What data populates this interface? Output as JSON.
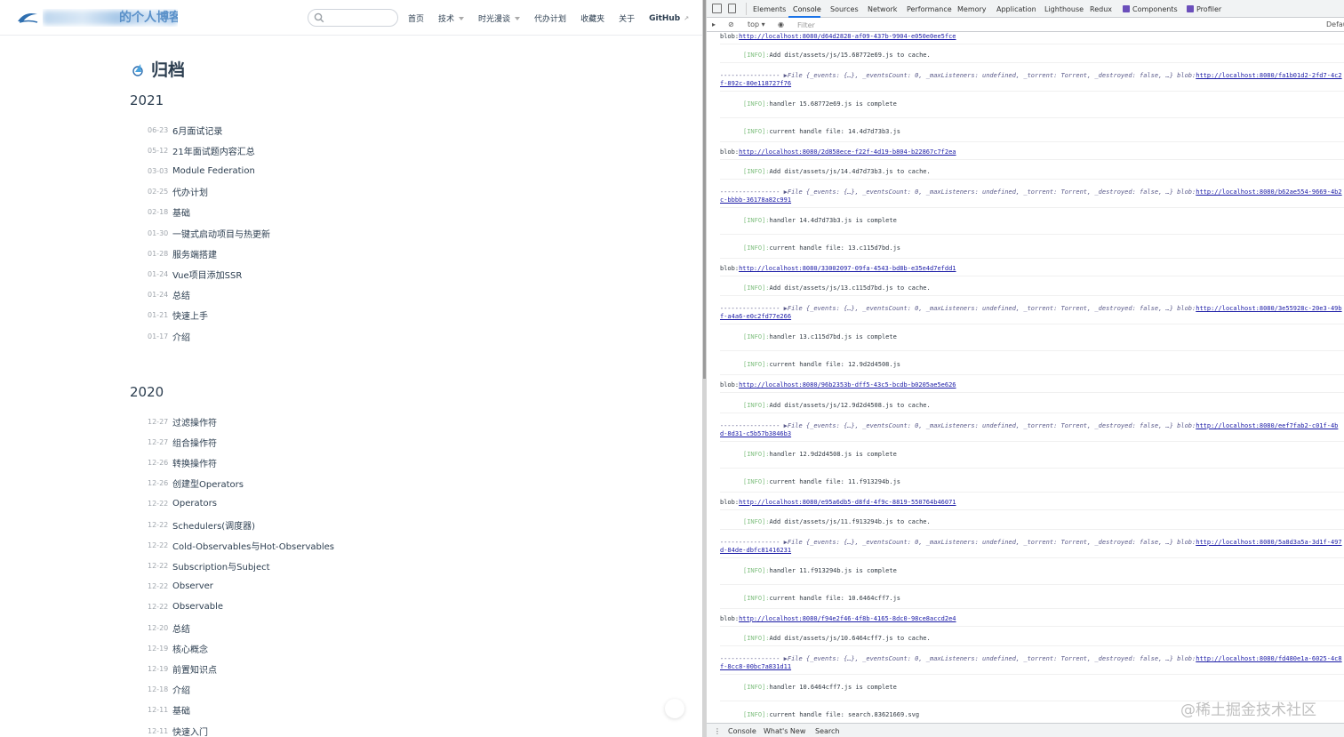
{
  "blog": {
    "site_title": "的个人博客",
    "nav": {
      "home": "首页",
      "tech": "技术",
      "time_notes": "时光漫谈",
      "todo": "代办计划",
      "favorites": "收藏夹",
      "about": "关于",
      "github": "GitHub"
    },
    "page_title": "归档",
    "years": [
      {
        "year": "2021",
        "posts": [
          {
            "date": "06-23",
            "title": "6月面试记录"
          },
          {
            "date": "05-12",
            "title": "21年面试题内容汇总"
          },
          {
            "date": "03-03",
            "title": "Module Federation"
          },
          {
            "date": "02-25",
            "title": "代办计划"
          },
          {
            "date": "02-18",
            "title": "基础"
          },
          {
            "date": "01-30",
            "title": "一键式启动项目与热更新"
          },
          {
            "date": "01-28",
            "title": "服务端搭建"
          },
          {
            "date": "01-24",
            "title": "Vue项目添加SSR"
          },
          {
            "date": "01-24",
            "title": "总结"
          },
          {
            "date": "01-21",
            "title": "快速上手"
          },
          {
            "date": "01-17",
            "title": "介绍"
          }
        ]
      },
      {
        "year": "2020",
        "posts": [
          {
            "date": "12-27",
            "title": "过滤操作符"
          },
          {
            "date": "12-27",
            "title": "组合操作符"
          },
          {
            "date": "12-26",
            "title": "转换操作符"
          },
          {
            "date": "12-26",
            "title": "创建型Operators"
          },
          {
            "date": "12-22",
            "title": "Operators"
          },
          {
            "date": "12-22",
            "title": "Schedulers(调度器)"
          },
          {
            "date": "12-22",
            "title": "Cold-Observables与Hot-Observables"
          },
          {
            "date": "12-22",
            "title": "Subscription与Subject"
          },
          {
            "date": "12-22",
            "title": "Observer"
          },
          {
            "date": "12-22",
            "title": "Observable"
          },
          {
            "date": "12-20",
            "title": "总结"
          },
          {
            "date": "12-19",
            "title": "核心概念"
          },
          {
            "date": "12-19",
            "title": "前置知识点"
          },
          {
            "date": "12-18",
            "title": "介绍"
          },
          {
            "date": "12-11",
            "title": "基础"
          },
          {
            "date": "12-11",
            "title": "快速入门"
          }
        ]
      }
    ]
  },
  "devtools": {
    "tabs": [
      "Elements",
      "Console",
      "Sources",
      "Network",
      "Performance",
      "Memory",
      "Application",
      "Lighthouse",
      "Redux",
      "Components",
      "Profiler"
    ],
    "active_tab": "Console",
    "context": "top",
    "filter_placeholder": "Filter",
    "levels": "Defau",
    "drawer_tabs": [
      "Console",
      "What's New",
      "Search"
    ],
    "log": {
      "info_tag": "[INFO]:",
      "file_prefix": "---------------- ▶File {_events: {…}, _eventsCount: 0, _maxListeners: undefined, _torrent: Torrent, _destroyed: false, …} blob:",
      "top_blob": "http://localhost:8080/d64d2828-af09-437b-9904-e050e0ee5fce",
      "groups": [
        {
          "add": "Add dist/assets/js/15.68772e69.js to cache.",
          "blob1": "http://localhost:8080/fa1b01d2-2fd7-4c2",
          "blob2": "f-892c-80e118727f76",
          "handler": "handler 15.68772e69.js is complete",
          "current": "current handle file: 14.4d7d73b3.js",
          "blob": "http://localhost:8080/2d858ece-f22f-4d19-b804-b22867c7f2ea"
        },
        {
          "add": "Add dist/assets/js/14.4d7d73b3.js to cache.",
          "blob1": "http://localhost:8080/b62ae554-9669-4b2",
          "blob2": "c-bbbb-36178a82c991",
          "handler": "handler 14.4d7d73b3.js is complete",
          "current": "current handle file: 13.c115d7bd.js",
          "blob": "http://localhost:8080/33002097-09fa-4543-bd8b-e35e4d7efdd1"
        },
        {
          "add": "Add dist/assets/js/13.c115d7bd.js to cache.",
          "blob1": "http://localhost:8080/3e55928c-20e3-49b",
          "blob2": "f-a4a6-e0c2fd77e266",
          "handler": "handler 13.c115d7bd.js is complete",
          "current": "current handle file: 12.9d2d4508.js",
          "blob": "http://localhost:8080/96b2353b-dff5-43c5-bcdb-b0205ae5e626"
        },
        {
          "add": "Add dist/assets/js/12.9d2d4508.js to cache.",
          "blob1": "http://localhost:8080/eef7fab2-c01f-4b",
          "blob2": "d-8d31-c5b57b3846b3",
          "handler": "handler 12.9d2d4508.js is complete",
          "current": "current handle file: 11.f913294b.js",
          "blob": "http://localhost:8080/e95a6db5-d8fd-4f9c-8819-550764b46071"
        },
        {
          "add": "Add dist/assets/js/11.f913294b.js to cache.",
          "blob1": "http://localhost:8080/5a8d3a5a-3d1f-497",
          "blob2": "d-84de-dbfc81416231",
          "handler": "handler 11.f913294b.js is complete",
          "current": "current handle file: 10.6464cff7.js",
          "blob": "http://localhost:8080/f94e2f46-4f8b-4165-8dc0-98ce8accd2e4"
        },
        {
          "add": "Add dist/assets/js/10.6464cff7.js to cache.",
          "blob1": "http://localhost:8080/fd480e1a-6025-4c8",
          "blob2": "f-8cc8-00bc7a831d11",
          "handler": "handler 10.6464cff7.js is complete",
          "current": "current handle file: search.83621669.svg",
          "blob": ""
        }
      ]
    }
  },
  "watermark": "@稀土掘金技术社区"
}
